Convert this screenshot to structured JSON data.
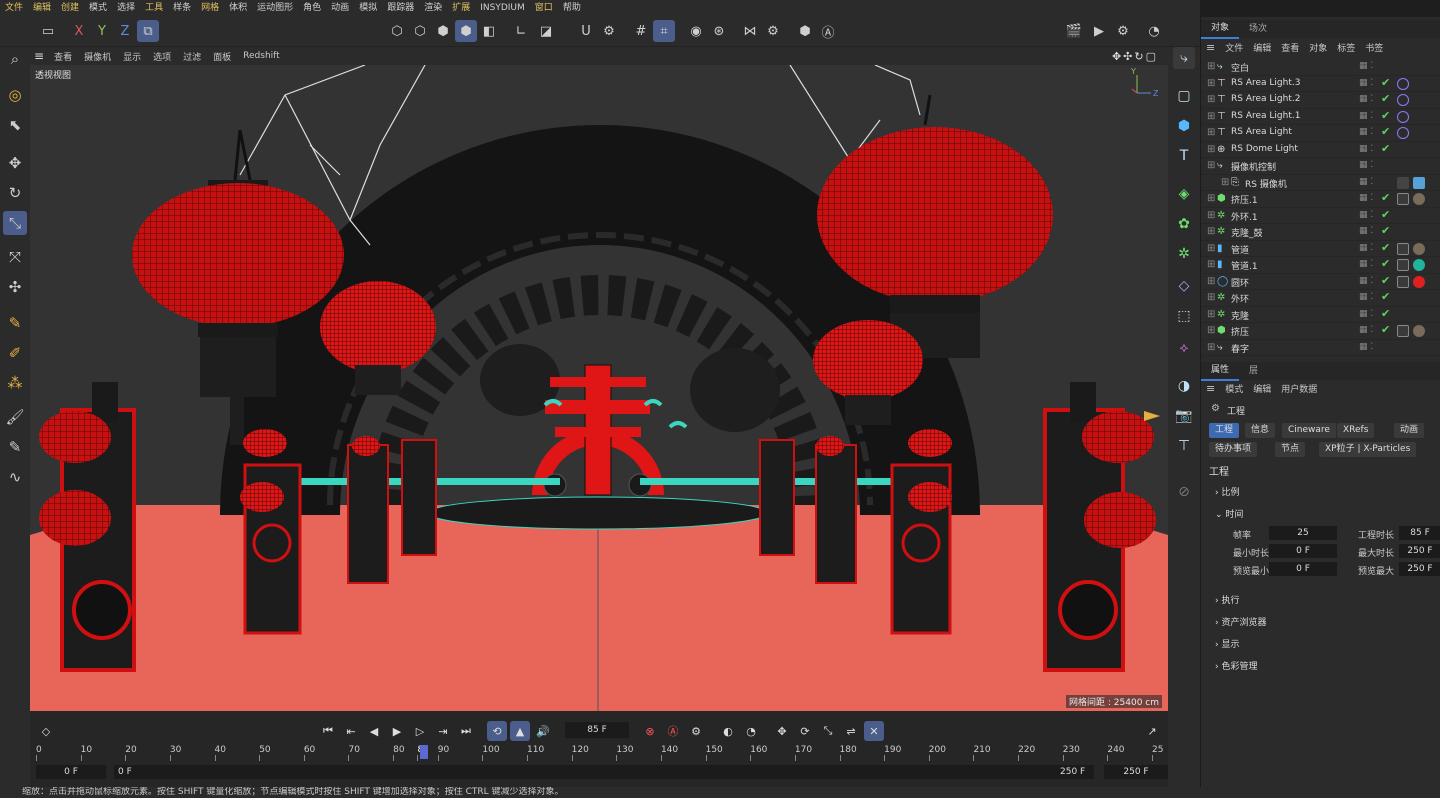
{
  "menu": [
    "文件",
    "编辑",
    "创建",
    "模式",
    "选择",
    "工具",
    "样条",
    "网格",
    "体积",
    "运动图形",
    "角色",
    "动画",
    "模拟",
    "跟踪器",
    "渲染",
    "扩展",
    "INSYDIUM",
    "窗口",
    "帮助"
  ],
  "viewport_menu": [
    "查看",
    "摄像机",
    "显示",
    "选项",
    "过滤",
    "面板",
    "Redshift"
  ],
  "viewport_label": "透视视图",
  "grid_spacing": "网格间距 : 25400 cm",
  "axis_labels": {
    "x": "X",
    "y": "Y",
    "z": "Z"
  },
  "timeline": {
    "current_frame": "85 F",
    "start": "0 F",
    "range_start": "0 F",
    "range_end": "250 F",
    "end": "250 F",
    "playhead_value": "85",
    "ticks": [
      "0",
      "10",
      "20",
      "30",
      "40",
      "50",
      "60",
      "70",
      "80",
      "90",
      "100",
      "110",
      "120",
      "130",
      "140",
      "150",
      "160",
      "170",
      "180",
      "190",
      "200",
      "210",
      "220",
      "230",
      "240",
      "25"
    ]
  },
  "status": "缩放：点击并拖动鼠标缩放元素。按住 SHIFT 键量化缩放；节点编辑模式时按住 SHIFT 键增加选择对象；按住 CTRL 键减少选择对象。",
  "objects_panel": {
    "tabs": [
      "对象",
      "场次"
    ],
    "menu": [
      "文件",
      "编辑",
      "查看",
      "对象",
      "标签",
      "书签"
    ],
    "items": [
      {
        "name": "空白",
        "icon": "null-icon",
        "indent": 0,
        "check": false,
        "tags": []
      },
      {
        "name": "RS Area Light.3",
        "icon": "area-light-icon",
        "indent": 0,
        "check": true,
        "tags": [
          "target"
        ]
      },
      {
        "name": "RS Area Light.2",
        "icon": "area-light-icon",
        "indent": 0,
        "check": true,
        "tags": [
          "target"
        ]
      },
      {
        "name": "RS Area Light.1",
        "icon": "area-light-icon",
        "indent": 0,
        "check": true,
        "tags": [
          "target"
        ]
      },
      {
        "name": "RS Area Light",
        "icon": "area-light-icon",
        "indent": 0,
        "check": true,
        "tags": [
          "target"
        ]
      },
      {
        "name": "RS Dome Light",
        "icon": "dome-light-icon",
        "indent": 0,
        "check": true,
        "tags": []
      },
      {
        "name": "摄像机控制",
        "icon": "null-icon",
        "indent": 0,
        "check": false,
        "tags": []
      },
      {
        "name": "RS 摄像机",
        "icon": "camera-icon",
        "indent": 1,
        "check": false,
        "tags": [
          "grid",
          "cam"
        ]
      },
      {
        "name": "挤压.1",
        "icon": "extrude-icon",
        "indent": 0,
        "check": true,
        "tags": [
          "mat",
          "sphere"
        ]
      },
      {
        "name": "外环.1",
        "icon": "cloner-icon",
        "indent": 0,
        "check": true,
        "tags": []
      },
      {
        "name": "克隆_鼓",
        "icon": "cloner-icon",
        "indent": 0,
        "check": true,
        "tags": []
      },
      {
        "name": "管道",
        "icon": "tube-icon",
        "indent": 0,
        "check": true,
        "tags": [
          "mat",
          "sphere"
        ]
      },
      {
        "name": "管道.1",
        "icon": "tube-icon",
        "indent": 0,
        "check": true,
        "tags": [
          "mat",
          "teal"
        ]
      },
      {
        "name": "圆环",
        "icon": "torus-icon",
        "indent": 0,
        "check": true,
        "tags": [
          "mat",
          "red"
        ]
      },
      {
        "name": "外环",
        "icon": "cloner-icon",
        "indent": 0,
        "check": true,
        "tags": []
      },
      {
        "name": "克隆",
        "icon": "cloner-icon",
        "indent": 0,
        "check": true,
        "tags": []
      },
      {
        "name": "挤压",
        "icon": "extrude-icon",
        "indent": 0,
        "check": true,
        "tags": [
          "mat",
          "sphere"
        ]
      },
      {
        "name": "春字",
        "icon": "null-icon",
        "indent": 0,
        "check": false,
        "tags": []
      }
    ]
  },
  "attributes_panel": {
    "tabs": [
      "属性",
      "层"
    ],
    "menu": [
      "模式",
      "编辑",
      "用户数据"
    ],
    "header": "工程",
    "buttons_row1": [
      "工程",
      "信息",
      "Cineware",
      "XRefs",
      "动画"
    ],
    "buttons_row2": [
      "待办事项",
      "节点",
      "XP粒子 | X-Particles"
    ],
    "section_title": "工程",
    "groups": [
      "比例",
      "时间",
      "执行",
      "资产浏览器",
      "显示",
      "色彩管理"
    ],
    "time_fields": [
      {
        "label": "帧率",
        "value": "25"
      },
      {
        "label": "工程时长",
        "value": "85 F"
      },
      {
        "label": "最小时长",
        "value": "0 F"
      },
      {
        "label": "最大时长",
        "value": "250 F"
      },
      {
        "label": "预览最小",
        "value": "0 F"
      },
      {
        "label": "预览最大",
        "value": "250 F"
      }
    ]
  },
  "colors": {
    "accent": "#3d6ab0",
    "floor": "#e8655a",
    "lantern": "#d01010",
    "teal": "#3ad6c0"
  }
}
